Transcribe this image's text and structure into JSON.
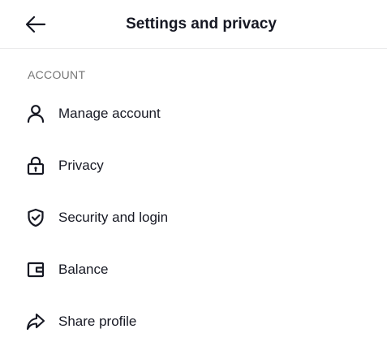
{
  "header": {
    "title": "Settings and privacy",
    "back_icon": "arrow-left-icon"
  },
  "section": {
    "label": "ACCOUNT"
  },
  "items": [
    {
      "label": "Manage account",
      "icon": "person-icon"
    },
    {
      "label": "Privacy",
      "icon": "lock-icon"
    },
    {
      "label": "Security and login",
      "icon": "shield-check-icon"
    },
    {
      "label": "Balance",
      "icon": "wallet-icon"
    },
    {
      "label": "Share profile",
      "icon": "share-icon"
    }
  ],
  "colors": {
    "text": "#161823",
    "secondary": "#757575",
    "divider": "#e9e9ea"
  }
}
